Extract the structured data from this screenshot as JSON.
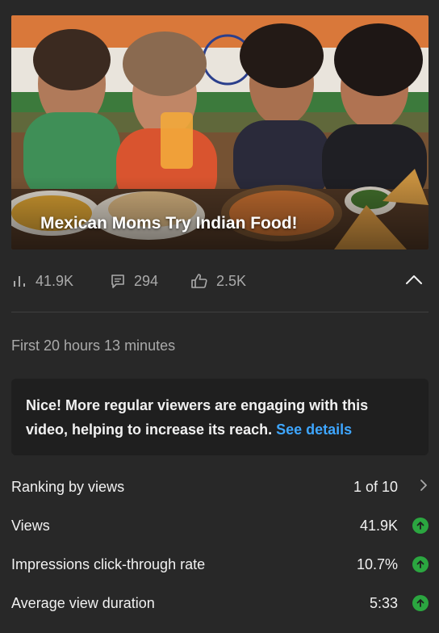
{
  "video": {
    "thumbnail_title": "Mexican Moms Try Indian Food!"
  },
  "stats": {
    "views": "41.9K",
    "comments": "294",
    "likes": "2.5K"
  },
  "period_label": "First 20 hours 13 minutes",
  "insight": {
    "message": "Nice! More regular viewers are engaging with this video, helping to increase its reach.",
    "link_label": "See details"
  },
  "metrics": [
    {
      "label": "Ranking by views",
      "value": "1 of 10",
      "indicator": "chevron-right-icon"
    },
    {
      "label": "Views",
      "value": "41.9K",
      "indicator": "arrow-up-icon"
    },
    {
      "label": "Impressions click-through rate",
      "value": "10.7%",
      "indicator": "arrow-up-icon"
    },
    {
      "label": "Average view duration",
      "value": "5:33",
      "indicator": "arrow-up-icon"
    }
  ],
  "colors": {
    "background": "#282828",
    "card": "#1f1f1f",
    "link": "#3ea6ff",
    "positive": "#2ba640",
    "muted_text": "#aaaaaa"
  }
}
